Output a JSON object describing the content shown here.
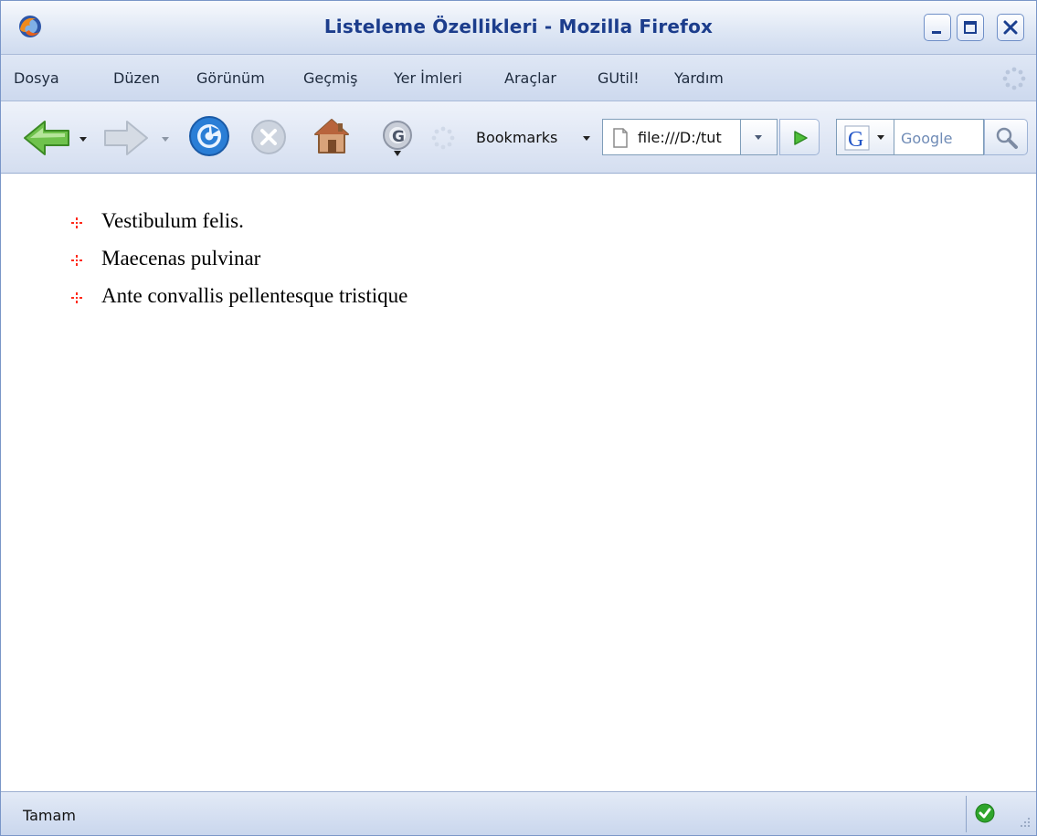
{
  "window": {
    "title": "Listeleme Özellikleri - Mozilla Firefox",
    "app_icon": "firefox-logo-icon",
    "controls": [
      "minimize-icon",
      "maximize-icon",
      "close-icon"
    ]
  },
  "menu": {
    "items": [
      "Dosya",
      "Düzen",
      "Görünüm",
      "Geçmiş",
      "Yer İmleri",
      "Araçlar",
      "GUtil!",
      "Yardım"
    ]
  },
  "toolbar": {
    "bookmarks_label": "Bookmarks",
    "url_value": "file:///D:/tut",
    "search_placeholder": "Google",
    "icons": [
      "back-icon",
      "forward-icon",
      "reload-icon",
      "stop-icon",
      "home-icon",
      "gutil-gear-icon",
      "throbber-icon",
      "go-icon",
      "google-icon",
      "magnifier-icon"
    ]
  },
  "content": {
    "list_items": [
      "Vestibulum felis.",
      "Maecenas pulvinar",
      "Ante convallis pellentesque tristique"
    ],
    "bullet_color": "#ff2a1a"
  },
  "status": {
    "text": "Tamam"
  },
  "colors": {
    "title_text": "#1c3d8c",
    "chrome_border": "#7a96c8"
  }
}
